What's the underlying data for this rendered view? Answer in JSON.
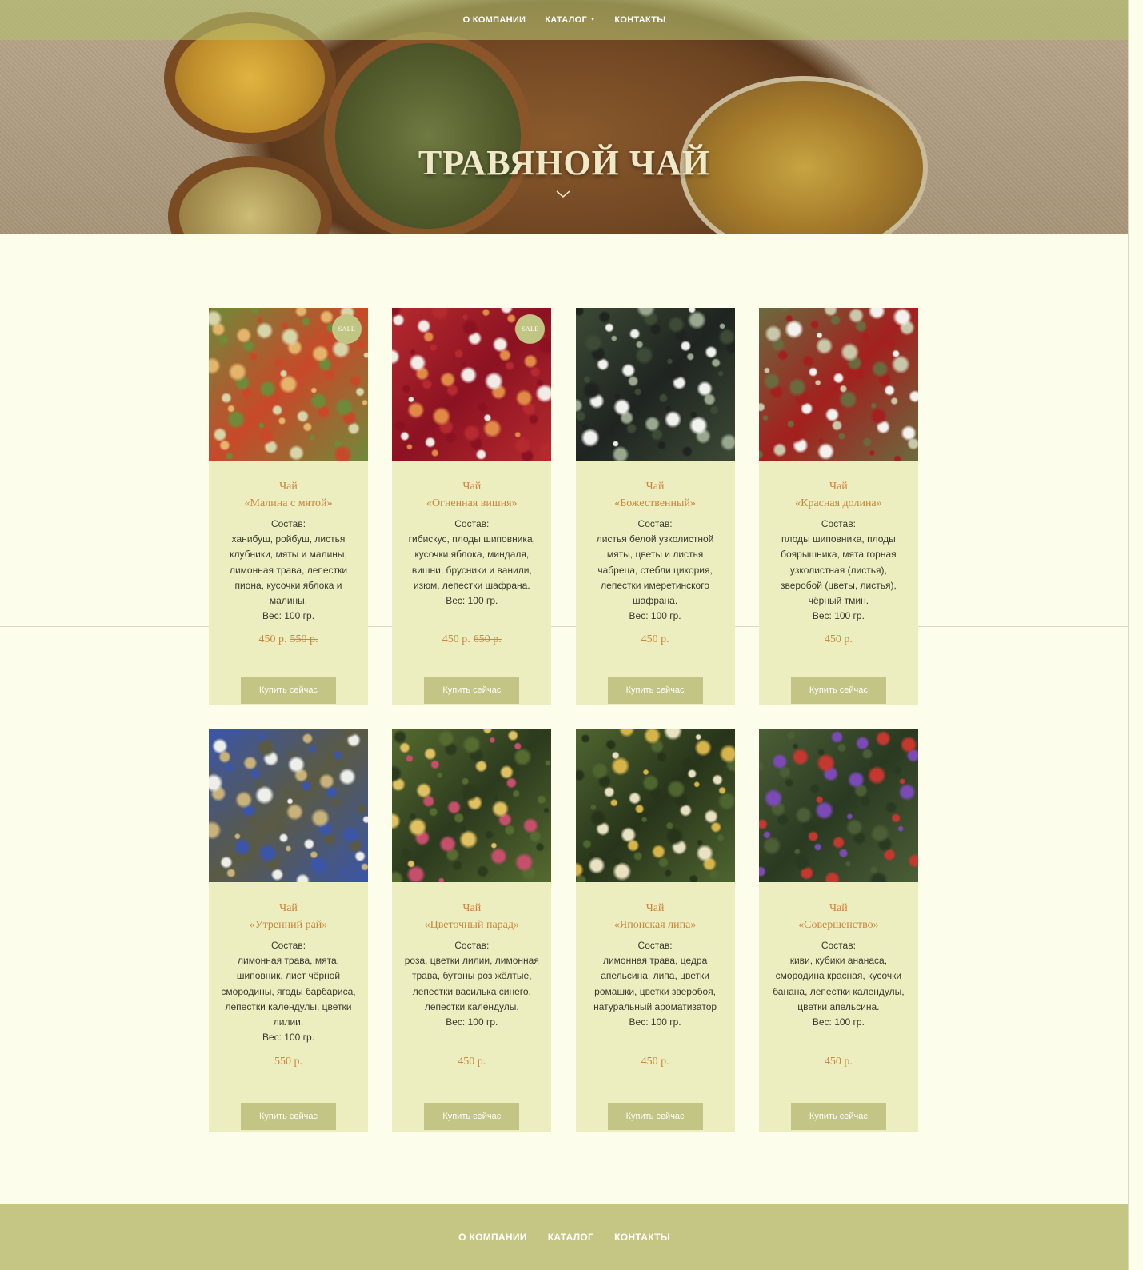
{
  "nav": {
    "items": [
      {
        "label": "О КОМПАНИИ",
        "has_dropdown": false
      },
      {
        "label": "КАТАЛОГ",
        "has_dropdown": true
      },
      {
        "label": "КОНТАКТЫ",
        "has_dropdown": false
      }
    ]
  },
  "hero": {
    "title": "ТРАВЯНОЙ ЧАЙ"
  },
  "products": [
    {
      "title_line1": "Чай",
      "title_line2": "«Малина с мятой»",
      "composition_label": "Состав:",
      "composition": "ханибуш, ройбуш, листья клубники, мяты и малины, лимонная трава, лепестки пиона, кусочки яблока и малины.",
      "weight": "Вес: 100 гр.",
      "price": "450 р.",
      "old_price": "550 р.",
      "sale_badge": "SALE",
      "button": "Купить сейчас",
      "image_colors": [
        "#c8492a",
        "#6f8a3a",
        "#e4b46a",
        "#d7d4a8"
      ]
    },
    {
      "title_line1": "Чай",
      "title_line2": "«Огненная вишня»",
      "composition_label": "Состав:",
      "composition": "гибискус, плоды шиповника, кусочки яблока, миндаля, вишни, брусники и ванили, изюм, лепестки шафрана.",
      "weight": "Вес: 100 гр.",
      "price": "450 р.",
      "old_price": "650 р.",
      "sale_badge": "SALE",
      "button": "Купить сейчас",
      "image_colors": [
        "#8c1222",
        "#b52a2e",
        "#e08a46",
        "#f3ece6"
      ]
    },
    {
      "title_line1": "Чай",
      "title_line2": "«Божественный»",
      "composition_label": "Состав:",
      "composition": "листья белой узколистной мяты, цветы и листья чабреца, стебли цикория, лепестки имеретинского шафрана.",
      "weight": "Вес: 100 гр.",
      "price": "450 р.",
      "old_price": "",
      "sale_badge": "",
      "button": "Купить сейчас",
      "image_colors": [
        "#1f2420",
        "#3d4a36",
        "#98a78e",
        "#f1f1ee"
      ]
    },
    {
      "title_line1": "Чай",
      "title_line2": "«Красная долина»",
      "composition_label": "Состав:",
      "composition": "плоды шиповника, плоды боярышника, мята горная узколистная (листья), зверобой (цветы, листья), чёрный тмин.",
      "weight": "Вес: 100 гр.",
      "price": "450 р.",
      "old_price": "",
      "sale_badge": "",
      "button": "Купить сейчас",
      "image_colors": [
        "#a3201e",
        "#6b6a3e",
        "#c9c7a9",
        "#f4f2ee"
      ]
    },
    {
      "title_line1": "Чай",
      "title_line2": "«Утренний рай»",
      "composition_label": "Состав:",
      "composition": "лимонная трава, мята, шиповник, лист чёрной смородины, ягоды барбариса, лепестки календулы, цветки лилии.",
      "weight": "Вес: 100 гр.",
      "price": "550 р.",
      "old_price": "",
      "sale_badge": "",
      "button": "Купить сейчас",
      "image_colors": [
        "#5a5a44",
        "#3b56a8",
        "#c9b27a",
        "#eeeeea"
      ]
    },
    {
      "title_line1": "Чай",
      "title_line2": "«Цветочный парад»",
      "composition_label": "Состав:",
      "composition": "роза, цветки лилии, лимонная трава, бутоны роз жёлтые, лепестки василька синего, лепестки календулы.",
      "weight": "Вес: 100 гр.",
      "price": "450 р.",
      "old_price": "",
      "sale_badge": "",
      "button": "Купить сейчас",
      "image_colors": [
        "#2c3a1e",
        "#556b2f",
        "#c74f6c",
        "#e0c060"
      ]
    },
    {
      "title_line1": "Чай",
      "title_line2": "«Японская липа»",
      "composition_label": "Состав:",
      "composition": "лимонная трава, цедра апельсина, липа, цветки ромашки, цветки зверобоя, натуральный ароматизатор",
      "weight": "Вес: 100 гр.",
      "price": "450 р.",
      "old_price": "",
      "sale_badge": "",
      "button": "Купить сейчас",
      "image_colors": [
        "#27341a",
        "#4f6530",
        "#d7b44a",
        "#e9e2c2"
      ]
    },
    {
      "title_line1": "Чай",
      "title_line2": "«Совершенство»",
      "composition_label": "Состав:",
      "composition": "киви, кубики ананаса, смородина красная, кусочки банана, лепестки календулы, цветки апельсина.",
      "weight": "Вес: 100 гр.",
      "price": "450 р.",
      "old_price": "",
      "sale_badge": "",
      "button": "Купить сейчас",
      "image_colors": [
        "#2a3a22",
        "#4b5e36",
        "#7c4ab8",
        "#c6382f"
      ]
    }
  ],
  "footer": {
    "items": [
      "О КОМПАНИИ",
      "КАТАЛОГ",
      "КОНТАКТЫ"
    ]
  },
  "colors": {
    "background": "#fdfdec",
    "nav_overlay": "#b4be6e",
    "card_bg": "#edeec0",
    "accent_text": "#c9863c",
    "button_bg": "#c2c583",
    "footer_bg": "#c5c684"
  }
}
